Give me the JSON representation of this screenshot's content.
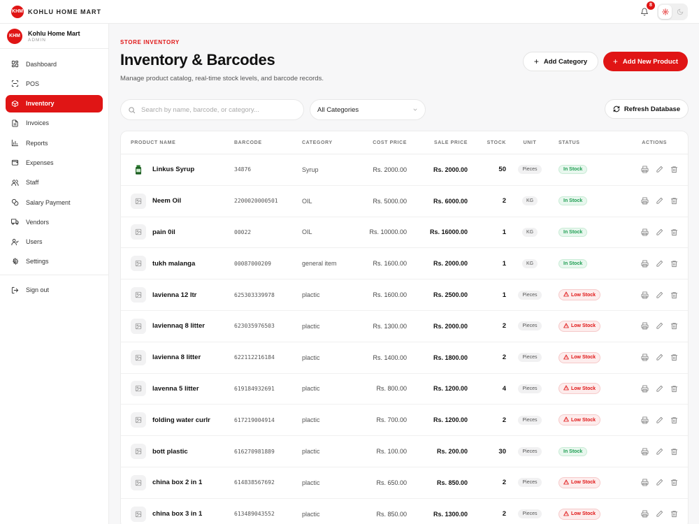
{
  "topbar": {
    "brand": "KOHLU HOME MART",
    "logo_text": "KHM",
    "notification_count": "8"
  },
  "sidebar": {
    "profile": {
      "name": "Kohlu Home Mart",
      "role": "ADMIN"
    },
    "items": [
      {
        "label": "Dashboard",
        "icon": "grid-icon"
      },
      {
        "label": "POS",
        "icon": "scan-icon"
      },
      {
        "label": "Inventory",
        "icon": "box-icon",
        "active": true
      },
      {
        "label": "Invoices",
        "icon": "document-icon"
      },
      {
        "label": "Reports",
        "icon": "bar-chart-icon"
      },
      {
        "label": "Expenses",
        "icon": "wallet-icon"
      },
      {
        "label": "Staff",
        "icon": "people-icon"
      },
      {
        "label": "Salary Payment",
        "icon": "coins-icon"
      },
      {
        "label": "Vendors",
        "icon": "truck-icon"
      },
      {
        "label": "Users",
        "icon": "user-check-icon"
      },
      {
        "label": "Settings",
        "icon": "gear-icon"
      }
    ],
    "signout": "Sign out"
  },
  "header": {
    "eyebrow": "STORE INVENTORY",
    "title": "Inventory & Barcodes",
    "subtitle": "Manage product catalog, real-time stock levels, and barcode records.",
    "add_category": "Add Category",
    "add_product": "Add New Product",
    "refresh": "Refresh Database"
  },
  "filters": {
    "search_placeholder": "Search by name, barcode, or category...",
    "category_selected": "All Categories"
  },
  "table": {
    "columns": [
      "PRODUCT NAME",
      "BARCODE",
      "CATEGORY",
      "COST PRICE",
      "SALE PRICE",
      "STOCK",
      "UNIT",
      "STATUS",
      "ACTIONS"
    ],
    "rows": [
      {
        "name": "Linkus Syrup",
        "barcode": "34876",
        "category": "Syrup",
        "cost": "Rs. 2000.00",
        "sale": "Rs. 2000.00",
        "stock": "50",
        "unit": "Pieces",
        "status": "In Stock",
        "thumb": "bottle"
      },
      {
        "name": "Neem Oil",
        "barcode": "2200020000501",
        "category": "OIL",
        "cost": "Rs. 5000.00",
        "sale": "Rs. 6000.00",
        "stock": "2",
        "unit": "KG",
        "status": "In Stock"
      },
      {
        "name": "pain 0il",
        "barcode": "00022",
        "category": "OIL",
        "cost": "Rs. 10000.00",
        "sale": "Rs. 16000.00",
        "stock": "1",
        "unit": "KG",
        "status": "In Stock"
      },
      {
        "name": "tukh malanga",
        "barcode": "00087000209",
        "category": "general item",
        "cost": "Rs. 1600.00",
        "sale": "Rs. 2000.00",
        "stock": "1",
        "unit": "KG",
        "status": "In Stock"
      },
      {
        "name": "lavienna 12 ltr",
        "barcode": "625303339978",
        "category": "plactic",
        "cost": "Rs. 1600.00",
        "sale": "Rs. 2500.00",
        "stock": "1",
        "unit": "Pieces",
        "status": "Low Stock"
      },
      {
        "name": "laviennaq 8 litter",
        "barcode": "623035976503",
        "category": "plactic",
        "cost": "Rs. 1300.00",
        "sale": "Rs. 2000.00",
        "stock": "2",
        "unit": "Pieces",
        "status": "Low Stock"
      },
      {
        "name": "lavienna 8 litter",
        "barcode": "622112216184",
        "category": "plactic",
        "cost": "Rs. 1400.00",
        "sale": "Rs. 1800.00",
        "stock": "2",
        "unit": "Pieces",
        "status": "Low Stock"
      },
      {
        "name": "lavenna 5 litter",
        "barcode": "619184932691",
        "category": "plactic",
        "cost": "Rs. 800.00",
        "sale": "Rs. 1200.00",
        "stock": "4",
        "unit": "Pieces",
        "status": "Low Stock"
      },
      {
        "name": "folding water curlr",
        "barcode": "617219004914",
        "category": "plactic",
        "cost": "Rs. 700.00",
        "sale": "Rs. 1200.00",
        "stock": "2",
        "unit": "Pieces",
        "status": "Low Stock"
      },
      {
        "name": "bott plastic",
        "barcode": "616270981889",
        "category": "plactic",
        "cost": "Rs. 100.00",
        "sale": "Rs. 200.00",
        "stock": "30",
        "unit": "Pieces",
        "status": "In Stock"
      },
      {
        "name": "china box 2 in 1",
        "barcode": "614838567692",
        "category": "plactic",
        "cost": "Rs. 650.00",
        "sale": "Rs. 850.00",
        "stock": "2",
        "unit": "Pieces",
        "status": "Low Stock"
      },
      {
        "name": "china box 3 in 1",
        "barcode": "613489043552",
        "category": "plactic",
        "cost": "Rs. 850.00",
        "sale": "Rs. 1300.00",
        "stock": "2",
        "unit": "Pieces",
        "status": "Low Stock"
      }
    ]
  },
  "colors": {
    "accent": "#e01515",
    "in_stock": "#1e9e52",
    "low_stock": "#e01515"
  }
}
